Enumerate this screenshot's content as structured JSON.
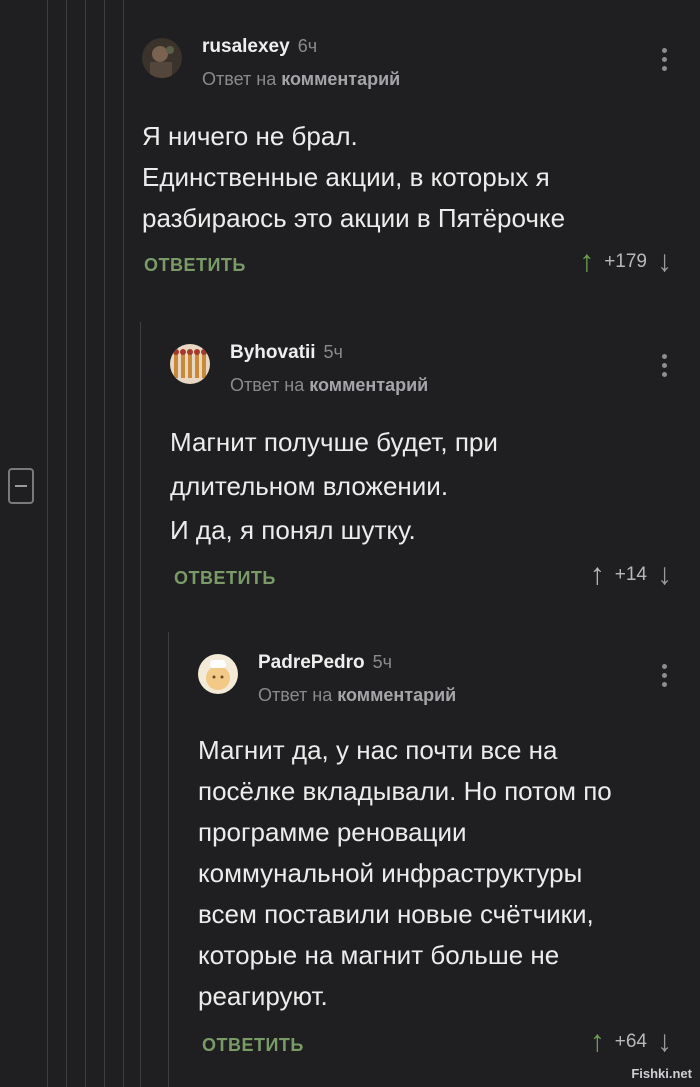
{
  "comments": [
    {
      "user": "rusalexey",
      "time": "6ч",
      "reply_prefix": "Ответ на",
      "reply_target": "комментарий",
      "text": "Я ничего не брал.\nЕдинственные акции, в которых я разбираюсь это акции в Пятёрочке",
      "reply_label": "ОТВЕТИТЬ",
      "score": "+179",
      "vote_up_icon": "arrow-up-icon",
      "vote_down_icon": "arrow-down-icon"
    },
    {
      "user": "Byhovatii",
      "time": "5ч",
      "reply_prefix": "Ответ на",
      "reply_target": "комментарий",
      "text": "Магнит получше будет, при длительном вложении.\nИ да, я понял шутку.",
      "reply_label": "ОТВЕТИТЬ",
      "score": "+14",
      "vote_up_icon": "arrow-up-icon",
      "vote_down_icon": "arrow-down-icon"
    },
    {
      "user": "PadrePedro",
      "time": "5ч",
      "reply_prefix": "Ответ на",
      "reply_target": "комментарий",
      "text": "Магнит да, у нас почти все на посёлке вкладывали. Но потом по программе реновации коммунальной инфраструктуры всем поставили новые счётчики, которые на магнит больше не реагируют.",
      "reply_label": "ОТВЕТИТЬ",
      "score": "+64",
      "vote_up_icon": "arrow-up-icon",
      "vote_down_icon": "arrow-down-icon"
    }
  ],
  "watermark": "Fishki.net",
  "colors": {
    "background": "#1f1f21",
    "reply_button": "#7a9b68",
    "upvoted_arrow": "#6ea052"
  }
}
